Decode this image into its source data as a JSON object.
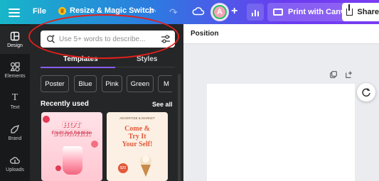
{
  "topbar": {
    "file_label": "File",
    "resize_label": "Resize & Magic Switch",
    "avatar_initial": "A",
    "print_label": "Print with Canva",
    "share_label": "Share"
  },
  "rail": {
    "items": [
      {
        "label": "Design",
        "icon": "design-icon"
      },
      {
        "label": "Elements",
        "icon": "elements-icon"
      },
      {
        "label": "Text",
        "icon": "text-icon"
      },
      {
        "label": "Brand",
        "icon": "brand-icon"
      },
      {
        "label": "Uploads",
        "icon": "uploads-icon"
      }
    ]
  },
  "panel": {
    "search_placeholder": "Use 5+ words to describe...",
    "tabs": [
      {
        "label": "Templates",
        "active": true
      },
      {
        "label": "Styles",
        "active": false
      }
    ],
    "chips": [
      "Poster",
      "Blue",
      "Pink",
      "Green",
      "M"
    ],
    "recent_label": "Recently used",
    "see_all": "See all",
    "thumbs": [
      {
        "title": "HOT SUMMER",
        "subtitle": "Fresh And Premium"
      },
      {
        "small": "ADVERTISE & MARKET",
        "title_line1": "Come &",
        "title_line2": "Try It",
        "title_line3": "Your Self!",
        "badge": "$20"
      }
    ]
  },
  "workspace": {
    "position_label": "Position"
  },
  "colors": {
    "gradient_start": "#17b6c9",
    "gradient_end": "#7b3df2",
    "panel_bg": "#252627",
    "rail_bg": "#18191b",
    "accent": "#8b5cf6",
    "highlight": "#e3201d"
  }
}
